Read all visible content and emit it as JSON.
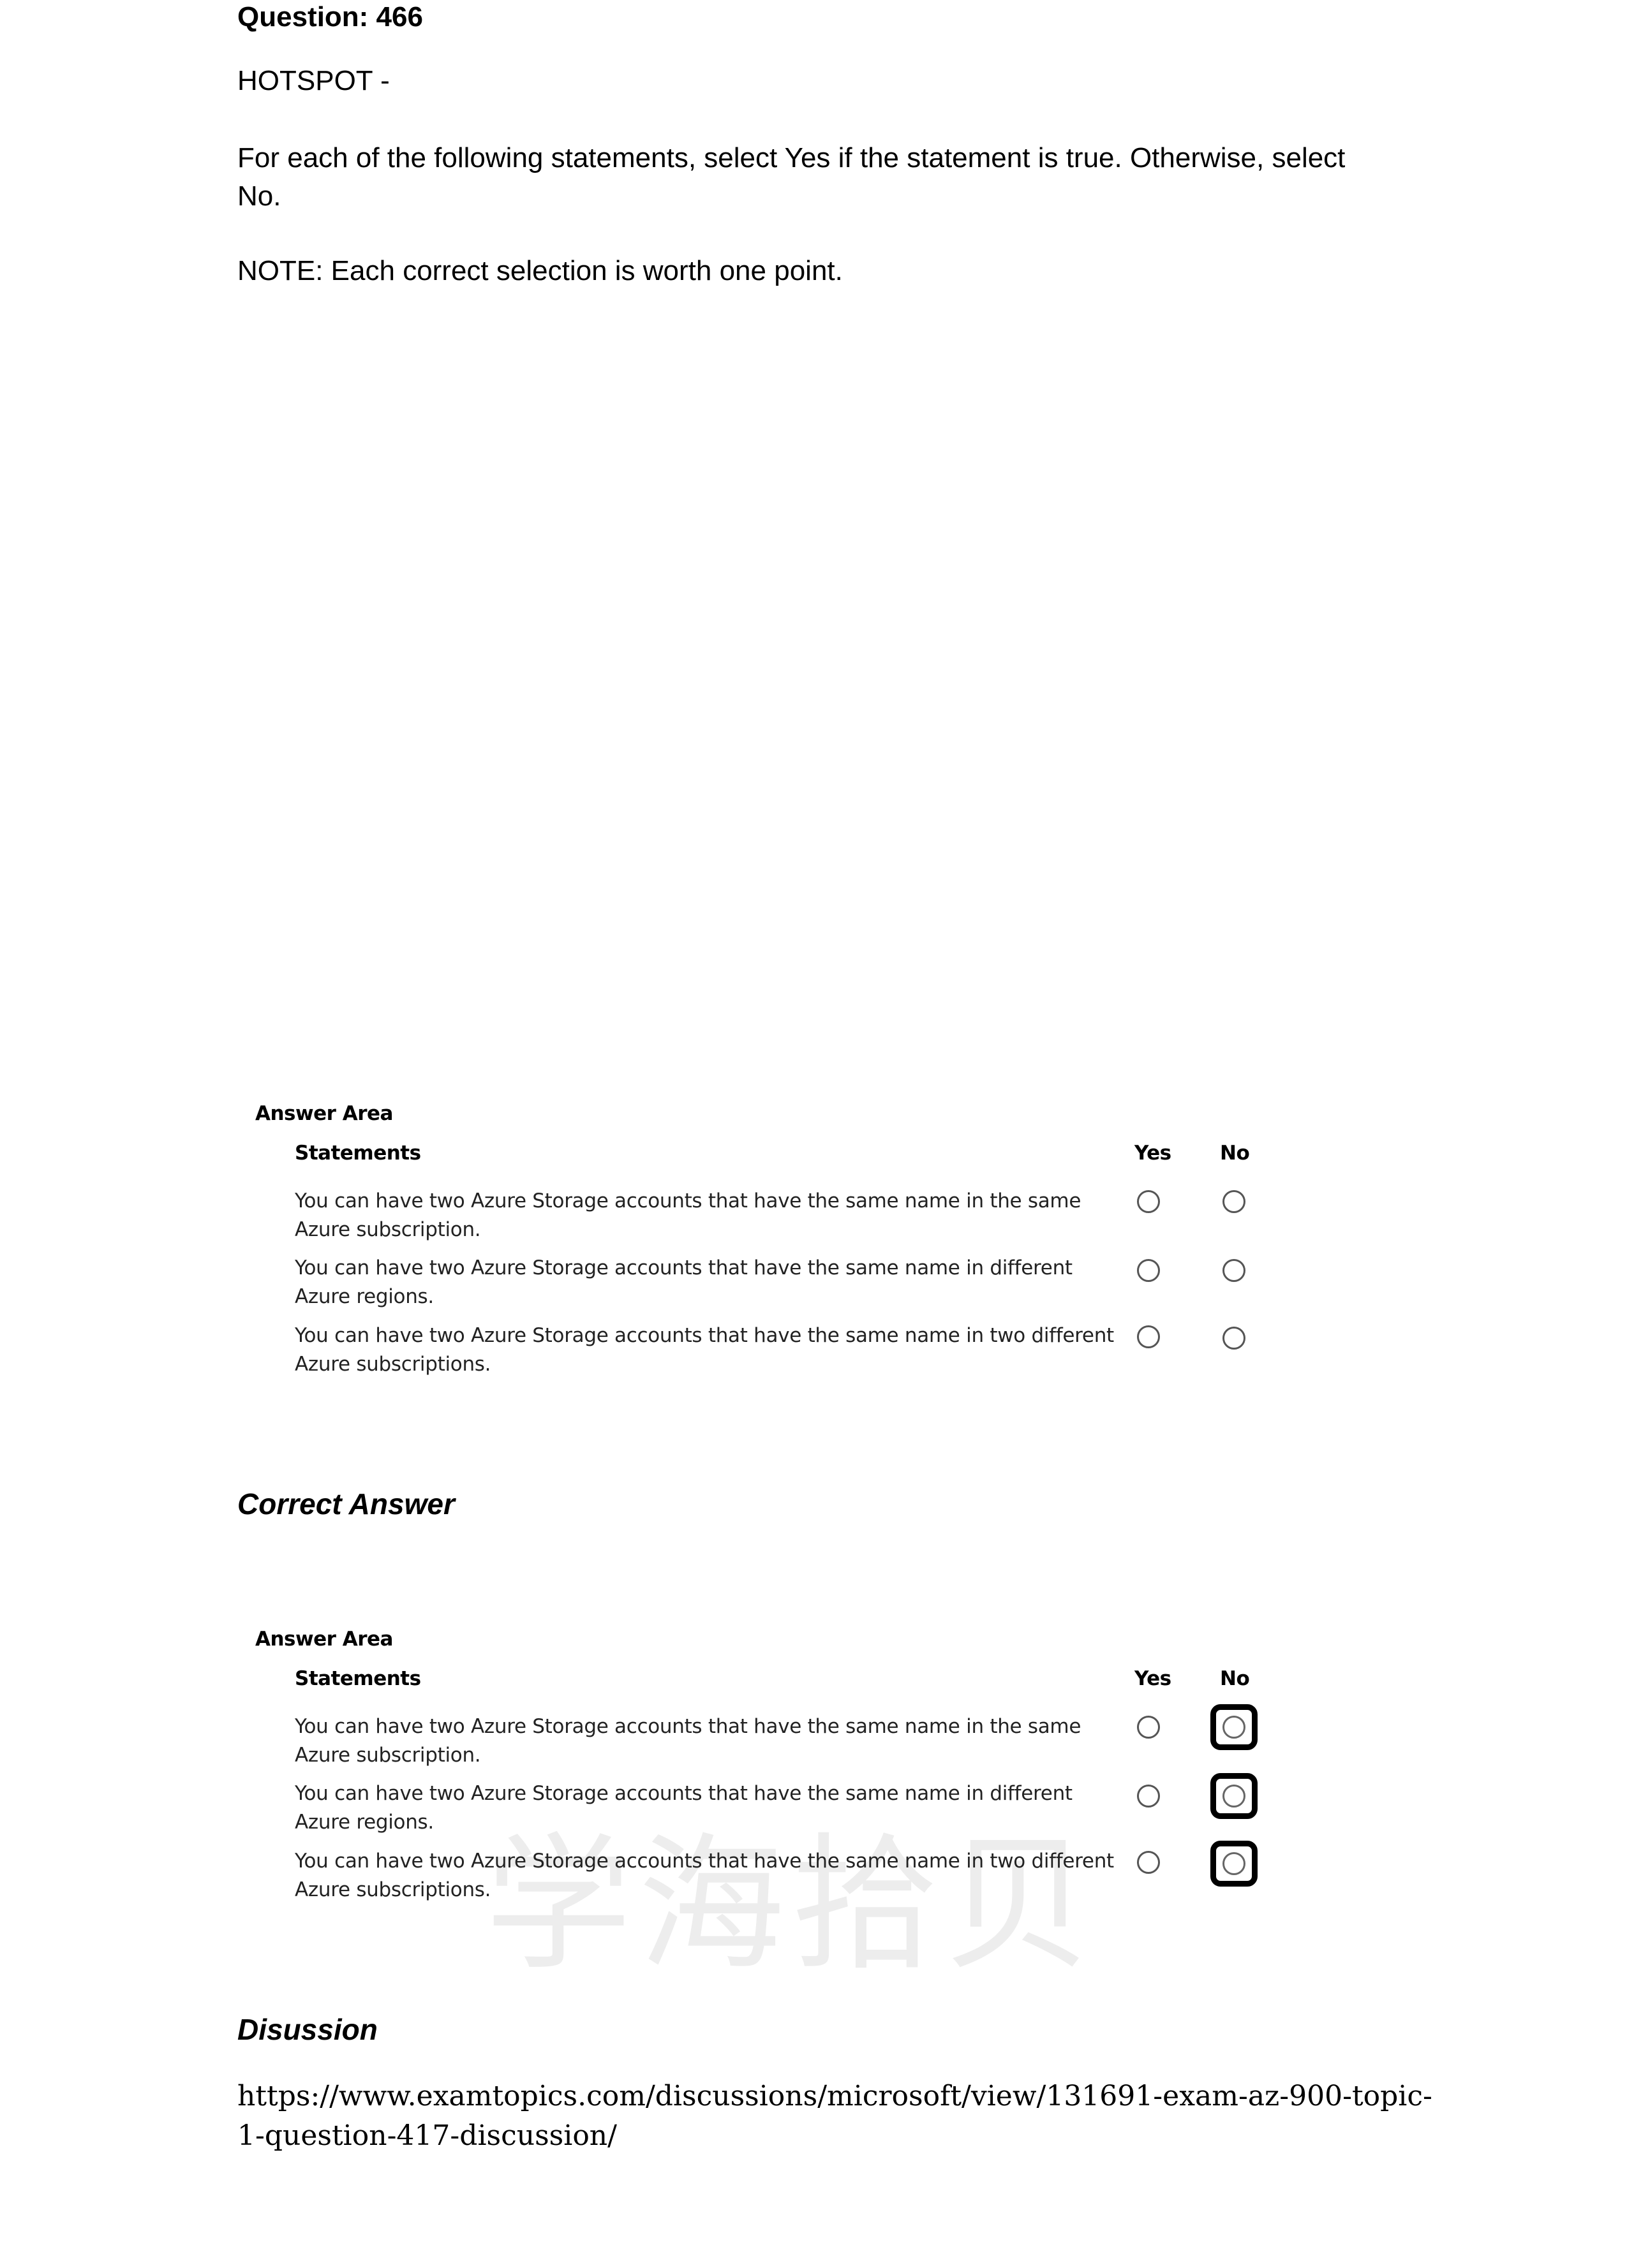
{
  "question": {
    "title": "Question: 466",
    "type": "HOTSPOT -",
    "text": "For each of the following statements, select Yes if the statement is true. Otherwise, select No.",
    "note": "NOTE: Each correct selection is worth one point."
  },
  "answer_area": {
    "title": "Answer Area",
    "col_statements": "Statements",
    "col_yes": "Yes",
    "col_no": "No",
    "rows": [
      {
        "statement": "You can have two Azure Storage accounts that have the same name in the same Azure subscription."
      },
      {
        "statement": "You can have two Azure Storage accounts that have the same name in different Azure regions."
      },
      {
        "statement": "You can have two Azure Storage accounts that have the same name in two different Azure subscriptions."
      }
    ]
  },
  "correct_answer": {
    "heading": "Correct Answer",
    "title": "Answer Area",
    "col_statements": "Statements",
    "col_yes": "Yes",
    "col_no": "No",
    "rows": [
      {
        "statement": "You can have two Azure Storage accounts that have the same name in the same Azure subscription.",
        "selected": "No"
      },
      {
        "statement": "You can have two Azure Storage accounts that have the same name in different Azure regions.",
        "selected": "No"
      },
      {
        "statement": "You can have two Azure Storage accounts that have the same name in two different Azure subscriptions.",
        "selected": "No"
      }
    ],
    "watermark": "学海拾贝"
  },
  "discussion": {
    "heading": "Disussion",
    "link": "https://www.examtopics.com/discussions/microsoft/view/131691-exam-az-900-topic-1-question-417-discussion/"
  }
}
